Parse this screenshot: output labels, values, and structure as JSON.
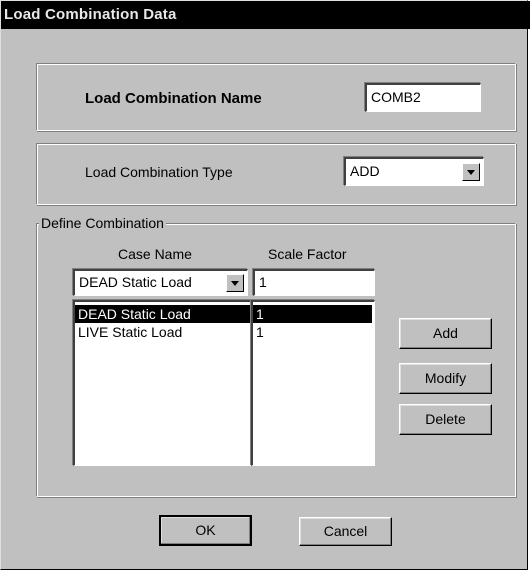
{
  "window": {
    "title": "Load Combination Data"
  },
  "name_group": {
    "label": "Load Combination Name",
    "value": "COMB2"
  },
  "type_group": {
    "label": "Load Combination Type",
    "selected": "ADD"
  },
  "define_group": {
    "label": "Define Combination",
    "case_name_header": "Case Name",
    "scale_factor_header": "Scale Factor",
    "case_dropdown_selected": "DEAD Static Load",
    "scale_factor_value": "1",
    "case_list": [
      {
        "name": "DEAD Static Load",
        "factor": "1",
        "selected": true
      },
      {
        "name": "LIVE Static Load",
        "factor": "1",
        "selected": false
      }
    ],
    "add_label": "Add",
    "modify_label": "Modify",
    "delete_label": "Delete"
  },
  "footer": {
    "ok_label": "OK",
    "cancel_label": "Cancel"
  }
}
